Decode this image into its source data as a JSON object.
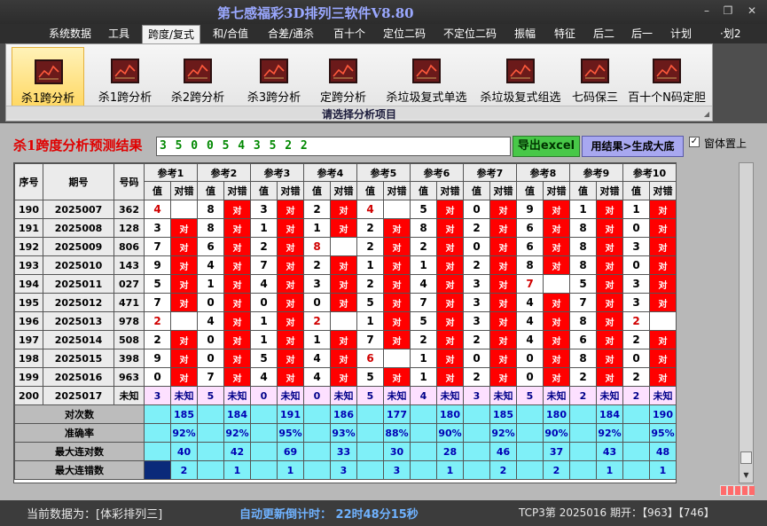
{
  "window": {
    "title": "第七感福彩3D排列三软件V8.80"
  },
  "menu": [
    {
      "label": "系统数据",
      "active": false
    },
    {
      "label": "工具",
      "active": false
    },
    {
      "label": "跨度/复式",
      "active": true
    },
    {
      "label": "和/合值",
      "active": false
    },
    {
      "label": "合差/通杀",
      "active": false
    },
    {
      "label": "百十个",
      "active": false
    },
    {
      "label": "定位二码",
      "active": false
    },
    {
      "label": "不定位二码",
      "active": false
    },
    {
      "label": "振幅",
      "active": false
    },
    {
      "label": "特征",
      "active": false
    },
    {
      "label": "后二",
      "active": false
    },
    {
      "label": "后一",
      "active": false
    },
    {
      "label": "计划",
      "active": false
    },
    {
      "label": "·划2",
      "active": false
    }
  ],
  "ribbon": {
    "caption": "请选择分析项目",
    "buttons": [
      {
        "label": "杀1跨分析",
        "selected": true,
        "icon": "chart-icon"
      },
      {
        "label": "杀1跨分析",
        "selected": false,
        "icon": "chart-icon"
      },
      {
        "label": "杀2跨分析",
        "selected": false,
        "icon": "chart-icon"
      },
      {
        "label": "杀3跨分析",
        "selected": false,
        "icon": "chart-icon"
      },
      {
        "label": "定跨分析",
        "selected": false,
        "icon": "chart-icon"
      },
      {
        "label": "杀垃圾复式单选",
        "selected": false,
        "icon": "chart-icon"
      },
      {
        "label": "杀垃圾复式组选",
        "selected": false,
        "icon": "chart-icon"
      },
      {
        "label": "七码保三",
        "selected": false,
        "icon": "chart-icon"
      },
      {
        "label": "百十个N码定胆",
        "selected": false,
        "icon": "chart-icon"
      }
    ]
  },
  "result": {
    "title": "杀1跨度分析预测结果",
    "value": "3 5 0 0 5 4 3 5 2 2",
    "export_label": "导出excel",
    "generate_label": "用结果>生成大底",
    "topmost_label": "窗体置上",
    "topmost_checked": "✓"
  },
  "table": {
    "col_seq": "序号",
    "col_issue": "期号",
    "col_number": "号码",
    "refs": [
      "参考1",
      "参考2",
      "参考3",
      "参考4",
      "参考5",
      "参考6",
      "参考7",
      "参考8",
      "参考9",
      "参考10"
    ],
    "sub_value": "值",
    "sub_result": "对错",
    "right_mark": "对",
    "rows": [
      {
        "seq": "190",
        "issue": "2025007",
        "number": "362",
        "cells": [
          [
            "4",
            "x"
          ],
          [
            "8",
            "r"
          ],
          [
            "3",
            "r"
          ],
          [
            "2",
            "r"
          ],
          [
            "4",
            "x"
          ],
          [
            "5",
            "r"
          ],
          [
            "0",
            "r"
          ],
          [
            "9",
            "r"
          ],
          [
            "1",
            "r"
          ],
          [
            "1",
            "r"
          ]
        ]
      },
      {
        "seq": "191",
        "issue": "2025008",
        "number": "128",
        "cells": [
          [
            "3",
            "r"
          ],
          [
            "8",
            "r"
          ],
          [
            "1",
            "r"
          ],
          [
            "1",
            "r"
          ],
          [
            "2",
            "r"
          ],
          [
            "8",
            "r"
          ],
          [
            "2",
            "r"
          ],
          [
            "6",
            "r"
          ],
          [
            "8",
            "r"
          ],
          [
            "0",
            "r"
          ]
        ]
      },
      {
        "seq": "192",
        "issue": "2025009",
        "number": "806",
        "cells": [
          [
            "7",
            "r"
          ],
          [
            "6",
            "r"
          ],
          [
            "2",
            "r"
          ],
          [
            "8",
            "x"
          ],
          [
            "2",
            "r"
          ],
          [
            "2",
            "r"
          ],
          [
            "0",
            "r"
          ],
          [
            "6",
            "r"
          ],
          [
            "8",
            "r"
          ],
          [
            "3",
            "r"
          ]
        ]
      },
      {
        "seq": "193",
        "issue": "2025010",
        "number": "143",
        "cells": [
          [
            "9",
            "r"
          ],
          [
            "4",
            "r"
          ],
          [
            "7",
            "r"
          ],
          [
            "2",
            "r"
          ],
          [
            "1",
            "r"
          ],
          [
            "1",
            "r"
          ],
          [
            "2",
            "r"
          ],
          [
            "8",
            "r"
          ],
          [
            "8",
            "r"
          ],
          [
            "0",
            "r"
          ]
        ]
      },
      {
        "seq": "194",
        "issue": "2025011",
        "number": "027",
        "cells": [
          [
            "5",
            "r"
          ],
          [
            "1",
            "r"
          ],
          [
            "4",
            "r"
          ],
          [
            "3",
            "r"
          ],
          [
            "2",
            "r"
          ],
          [
            "4",
            "r"
          ],
          [
            "3",
            "r"
          ],
          [
            "7",
            "x"
          ],
          [
            "5",
            "r"
          ],
          [
            "3",
            "r"
          ]
        ]
      },
      {
        "seq": "195",
        "issue": "2025012",
        "number": "471",
        "cells": [
          [
            "7",
            "r"
          ],
          [
            "0",
            "r"
          ],
          [
            "0",
            "r"
          ],
          [
            "0",
            "r"
          ],
          [
            "5",
            "r"
          ],
          [
            "7",
            "r"
          ],
          [
            "3",
            "r"
          ],
          [
            "4",
            "r"
          ],
          [
            "7",
            "r"
          ],
          [
            "3",
            "r"
          ]
        ]
      },
      {
        "seq": "196",
        "issue": "2025013",
        "number": "978",
        "cells": [
          [
            "2",
            "x"
          ],
          [
            "4",
            "r"
          ],
          [
            "1",
            "r"
          ],
          [
            "2",
            "x"
          ],
          [
            "1",
            "r"
          ],
          [
            "5",
            "r"
          ],
          [
            "3",
            "r"
          ],
          [
            "4",
            "r"
          ],
          [
            "8",
            "r"
          ],
          [
            "2",
            "x"
          ]
        ]
      },
      {
        "seq": "197",
        "issue": "2025014",
        "number": "508",
        "cells": [
          [
            "2",
            "r"
          ],
          [
            "0",
            "r"
          ],
          [
            "1",
            "r"
          ],
          [
            "1",
            "r"
          ],
          [
            "7",
            "r"
          ],
          [
            "2",
            "r"
          ],
          [
            "2",
            "r"
          ],
          [
            "4",
            "r"
          ],
          [
            "6",
            "r"
          ],
          [
            "2",
            "r"
          ]
        ]
      },
      {
        "seq": "198",
        "issue": "2025015",
        "number": "398",
        "cells": [
          [
            "9",
            "r"
          ],
          [
            "0",
            "r"
          ],
          [
            "5",
            "r"
          ],
          [
            "4",
            "r"
          ],
          [
            "6",
            "x"
          ],
          [
            "1",
            "r"
          ],
          [
            "0",
            "r"
          ],
          [
            "0",
            "r"
          ],
          [
            "8",
            "r"
          ],
          [
            "0",
            "r"
          ]
        ]
      },
      {
        "seq": "199",
        "issue": "2025016",
        "number": "963",
        "cells": [
          [
            "0",
            "r"
          ],
          [
            "7",
            "r"
          ],
          [
            "4",
            "r"
          ],
          [
            "4",
            "r"
          ],
          [
            "5",
            "r"
          ],
          [
            "1",
            "r"
          ],
          [
            "2",
            "r"
          ],
          [
            "0",
            "r"
          ],
          [
            "2",
            "r"
          ],
          [
            "2",
            "r"
          ]
        ]
      }
    ],
    "prediction": {
      "seq": "200",
      "issue": "2025017",
      "number": "未知",
      "values": [
        "3",
        "5",
        "0",
        "0",
        "5",
        "4",
        "3",
        "5",
        "2",
        "2"
      ],
      "unknown": "未知"
    },
    "stats": [
      {
        "label": "对次数",
        "values": [
          "185",
          "184",
          "191",
          "186",
          "177",
          "180",
          "185",
          "180",
          "184",
          "190"
        ]
      },
      {
        "label": "准确率",
        "values": [
          "92%",
          "92%",
          "95%",
          "93%",
          "88%",
          "90%",
          "92%",
          "90%",
          "92%",
          "95%"
        ]
      },
      {
        "label": "最大连对数",
        "values": [
          "40",
          "42",
          "69",
          "33",
          "30",
          "28",
          "46",
          "37",
          "43",
          "48"
        ]
      },
      {
        "label": "最大连错数",
        "values": [
          "2",
          "1",
          "1",
          "3",
          "3",
          "1",
          "2",
          "2",
          "1",
          "1"
        ]
      }
    ]
  },
  "status": {
    "data_source": "当前数据为：[体彩排列三]",
    "timer": "自动更新倒计时：  22时48分15秒",
    "last_draw": "TCP3第 2025016 期开：【963】【746】"
  },
  "colors": {
    "right": "#ff0000",
    "miss_text": "#d00000",
    "prediction_row": "#fde0ff",
    "stats_row": "#7ff0f8"
  }
}
